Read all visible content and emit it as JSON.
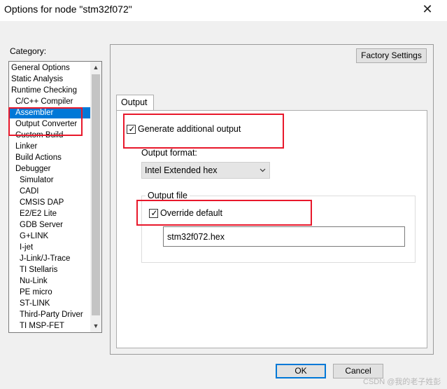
{
  "window": {
    "title": "Options for node \"stm32f072\"",
    "close_glyph": "✕"
  },
  "category": {
    "label": "Category:",
    "selected_index": 4,
    "items": [
      {
        "label": "General Options",
        "level": 0
      },
      {
        "label": "Static Analysis",
        "level": 0
      },
      {
        "label": "Runtime Checking",
        "level": 0
      },
      {
        "label": "C/C++ Compiler",
        "level": 1
      },
      {
        "label": "Assembler",
        "level": 1
      },
      {
        "label": "Output Converter",
        "level": 1
      },
      {
        "label": "Custom Build",
        "level": 1
      },
      {
        "label": "Linker",
        "level": 1
      },
      {
        "label": "Build Actions",
        "level": 1
      },
      {
        "label": "Debugger",
        "level": 1
      },
      {
        "label": "Simulator",
        "level": 2
      },
      {
        "label": "CADI",
        "level": 2
      },
      {
        "label": "CMSIS DAP",
        "level": 2
      },
      {
        "label": "E2/E2 Lite",
        "level": 2
      },
      {
        "label": "GDB Server",
        "level": 2
      },
      {
        "label": "G+LINK",
        "level": 2
      },
      {
        "label": "I-jet",
        "level": 2
      },
      {
        "label": "J-Link/J-Trace",
        "level": 2
      },
      {
        "label": "TI Stellaris",
        "level": 2
      },
      {
        "label": "Nu-Link",
        "level": 2
      },
      {
        "label": "PE micro",
        "level": 2
      },
      {
        "label": "ST-LINK",
        "level": 2
      },
      {
        "label": "Third-Party Driver",
        "level": 2
      },
      {
        "label": "TI MSP-FET",
        "level": 2
      }
    ]
  },
  "panel": {
    "factory_settings": "Factory Settings",
    "tab_label": "Output",
    "generate": {
      "label": "Generate additional output",
      "checked": true
    },
    "format": {
      "label": "Output format:",
      "value": "Intel Extended hex"
    },
    "output_file": {
      "group_label": "Output file",
      "override": {
        "label": "Override default",
        "checked": true
      },
      "filename": "stm32f072.hex"
    }
  },
  "buttons": {
    "ok": "OK",
    "cancel": "Cancel"
  },
  "watermark": "CSDN @我的老子姓彭",
  "colors": {
    "selection": "#0078d7",
    "highlight": "#e8182b"
  }
}
